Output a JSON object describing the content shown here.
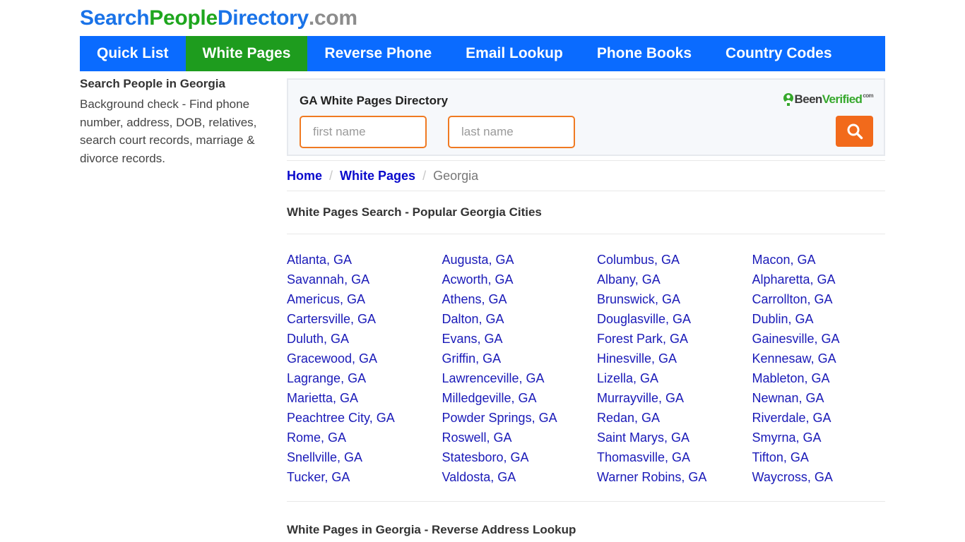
{
  "logo": {
    "part1": "Search",
    "part2": "People",
    "part3": "Directory",
    "part4": ".com"
  },
  "nav": [
    {
      "label": "Quick List",
      "active": false
    },
    {
      "label": "White Pages",
      "active": true
    },
    {
      "label": "Reverse Phone",
      "active": false
    },
    {
      "label": "Email Lookup",
      "active": false
    },
    {
      "label": "Phone Books",
      "active": false
    },
    {
      "label": "Country Codes",
      "active": false
    }
  ],
  "sidebar": {
    "title": "Search People in Georgia",
    "text": "Background check - Find phone number, address, DOB, relatives, search court records, marriage & divorce records."
  },
  "search": {
    "title": "GA White Pages Directory",
    "first_placeholder": "first name",
    "last_placeholder": "last name",
    "brand_been": "Been",
    "brand_verified": "Verified",
    "brand_tm": "com",
    "colors": {
      "input_border": "#f07a22",
      "button": "#f26a1b",
      "brand_green": "#36a82c"
    }
  },
  "breadcrumb": {
    "home": "Home",
    "white_pages": "White Pages",
    "current": "Georgia"
  },
  "section1_title": "White Pages Search - Popular Georgia Cities",
  "cities": [
    "Atlanta,  GA",
    "Augusta,  GA",
    "Columbus,  GA",
    "Macon,  GA",
    "Savannah,  GA",
    "Acworth,  GA",
    "Albany,  GA",
    "Alpharetta,  GA",
    "Americus,  GA",
    "Athens,  GA",
    "Brunswick,  GA",
    "Carrollton,  GA",
    "Cartersville,  GA",
    "Dalton,  GA",
    "Douglasville,  GA",
    "Dublin,  GA",
    "Duluth,  GA",
    "Evans,  GA",
    "Forest Park,  GA",
    "Gainesville,  GA",
    "Gracewood,  GA",
    "Griffin,  GA",
    "Hinesville,  GA",
    "Kennesaw,  GA",
    "Lagrange,  GA",
    "Lawrenceville,  GA",
    "Lizella,  GA",
    "Mableton,  GA",
    "Marietta,  GA",
    "Milledgeville,  GA",
    "Murrayville,  GA",
    "Newnan,  GA",
    "Peachtree City,  GA",
    "Powder Springs,  GA",
    "Redan,  GA",
    "Riverdale,  GA",
    "Rome,  GA",
    "Roswell,  GA",
    "Saint Marys,  GA",
    "Smyrna,  GA",
    "Snellville,  GA",
    "Statesboro,  GA",
    "Thomasville,  GA",
    "Tifton,  GA",
    "Tucker,  GA",
    "Valdosta,  GA",
    "Warner Robins,  GA",
    "Waycross,  GA"
  ],
  "section2_title": "White Pages in Georgia - Reverse Address Lookup",
  "colors": {
    "nav_bg": "#0a6bff",
    "nav_active": "#1e9c1e",
    "link": "#1a1ab8"
  }
}
